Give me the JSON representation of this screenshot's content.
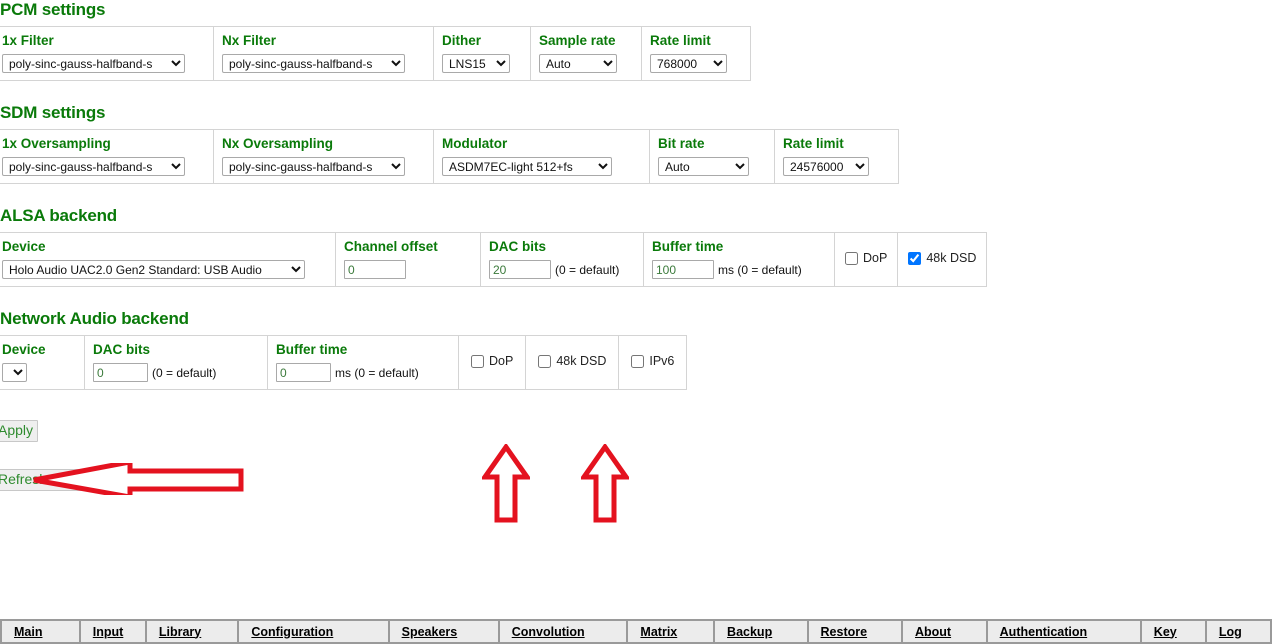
{
  "theme": {
    "heading_color": "#0a7a0a",
    "label_color": "#0a7a0a",
    "button_text_color": "#2e8b2e",
    "annotation_color": "#e4121f",
    "nav_background": "#ececec"
  },
  "sections": {
    "pcm": {
      "title": "PCM settings",
      "fields": [
        {
          "label": "1x Filter",
          "control": "select",
          "value": "poly-sinc-gauss-halfband-s",
          "name": "pcm-1x-filter-select"
        },
        {
          "label": "Nx Filter",
          "control": "select",
          "value": "poly-sinc-gauss-halfband-s",
          "name": "pcm-nx-filter-select"
        },
        {
          "label": "Dither",
          "control": "select",
          "value": "LNS15",
          "name": "pcm-dither-select"
        },
        {
          "label": "Sample rate",
          "control": "select",
          "value": "Auto",
          "name": "pcm-sample-rate-select"
        },
        {
          "label": "Rate limit",
          "control": "select",
          "value": "768000",
          "name": "pcm-rate-limit-select"
        }
      ]
    },
    "sdm": {
      "title": "SDM settings",
      "fields": [
        {
          "label": "1x Oversampling",
          "control": "select",
          "value": "poly-sinc-gauss-halfband-s",
          "name": "sdm-1x-oversampling-select"
        },
        {
          "label": "Nx Oversampling",
          "control": "select",
          "value": "poly-sinc-gauss-halfband-s",
          "name": "sdm-nx-oversampling-select"
        },
        {
          "label": "Modulator",
          "control": "select",
          "value": "ASDM7EC-light 512+fs",
          "name": "sdm-modulator-select"
        },
        {
          "label": "Bit rate",
          "control": "select",
          "value": "Auto",
          "name": "sdm-bit-rate-select"
        },
        {
          "label": "Rate limit",
          "control": "select",
          "value": "24576000",
          "name": "sdm-rate-limit-select"
        }
      ]
    },
    "alsa": {
      "title": "ALSA backend",
      "device_label": "Device",
      "device_value": "Holo Audio UAC2.0 Gen2 Standard: USB Audio",
      "channel_offset_label": "Channel offset",
      "channel_offset_value": "0",
      "dac_bits_label": "DAC bits",
      "dac_bits_value": "20",
      "dac_bits_hint": "(0 = default)",
      "buffer_time_label": "Buffer time",
      "buffer_time_value": "100",
      "buffer_time_hint": "ms (0 = default)",
      "checkboxes": [
        {
          "label": "DoP",
          "checked": false,
          "name": "alsa-dop-checkbox"
        },
        {
          "label": "48k DSD",
          "checked": true,
          "name": "alsa-48k-dsd-checkbox"
        }
      ]
    },
    "network": {
      "title": "Network Audio backend",
      "device_label": "Device",
      "device_value": "",
      "dac_bits_label": "DAC bits",
      "dac_bits_value": "0",
      "dac_bits_hint": "(0 = default)",
      "buffer_time_label": "Buffer time",
      "buffer_time_value": "0",
      "buffer_time_hint": "ms (0 = default)",
      "checkboxes": [
        {
          "label": "DoP",
          "checked": false,
          "name": "network-dop-checkbox"
        },
        {
          "label": "48k DSD",
          "checked": false,
          "name": "network-48k-dsd-checkbox"
        },
        {
          "label": "IPv6",
          "checked": false,
          "name": "network-ipv6-checkbox"
        }
      ]
    }
  },
  "actions": {
    "apply_label": "Apply",
    "refresh_label": "Refresh devices"
  },
  "navigation": {
    "items": [
      {
        "label": "Main",
        "name": "nav-main"
      },
      {
        "label": "Input",
        "name": "nav-input"
      },
      {
        "label": "Library",
        "name": "nav-library"
      },
      {
        "label": "Configuration",
        "name": "nav-configuration"
      },
      {
        "label": "Speakers",
        "name": "nav-speakers"
      },
      {
        "label": "Convolution",
        "name": "nav-convolution"
      },
      {
        "label": "Matrix",
        "name": "nav-matrix"
      },
      {
        "label": "Backup",
        "name": "nav-backup"
      },
      {
        "label": "Restore",
        "name": "nav-restore"
      },
      {
        "label": "About",
        "name": "nav-about"
      },
      {
        "label": "Authentication",
        "name": "nav-authentication"
      },
      {
        "label": "Key",
        "name": "nav-key"
      },
      {
        "label": "Log",
        "name": "nav-log"
      }
    ]
  },
  "annotations": {
    "left_arrow": "arrow-pointing-left-at-network-device-select",
    "up_arrow_1": "arrow-pointing-up-at-network-48k-dsd-checkbox",
    "up_arrow_2": "arrow-pointing-up-at-network-ipv6-checkbox"
  }
}
